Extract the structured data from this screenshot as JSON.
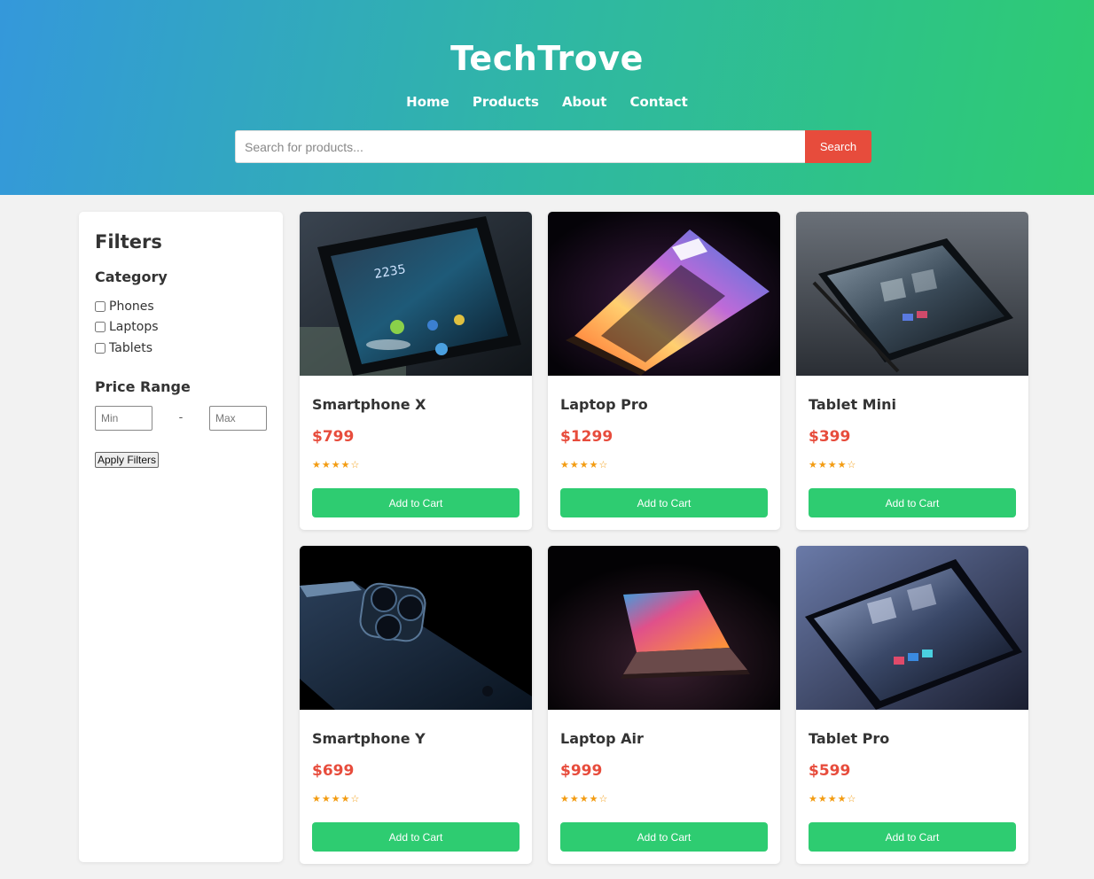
{
  "header": {
    "title": "TechTrove",
    "nav": [
      "Home",
      "Products",
      "About",
      "Contact"
    ],
    "search_placeholder": "Search for products...",
    "search_button": "Search",
    "gradient_colors": [
      "#3498db",
      "#2ecc71"
    ]
  },
  "sidebar": {
    "title": "Filters",
    "category_heading": "Category",
    "categories": [
      "Phones",
      "Laptops",
      "Tablets"
    ],
    "price_heading": "Price Range",
    "min_placeholder": "Min",
    "separator": "-",
    "max_placeholder": "Max",
    "apply_button": "Apply Filters"
  },
  "products": [
    {
      "name": "Smartphone X",
      "price": "$799",
      "rating": "★★★★☆",
      "button": "Add to Cart",
      "image_icon": "smartphone-photo"
    },
    {
      "name": "Laptop Pro",
      "price": "$1299",
      "rating": "★★★★☆",
      "button": "Add to Cart",
      "image_icon": "laptop-photo"
    },
    {
      "name": "Tablet Mini",
      "price": "$399",
      "rating": "★★★★☆",
      "button": "Add to Cart",
      "image_icon": "tablet-photo"
    },
    {
      "name": "Smartphone Y",
      "price": "$699",
      "rating": "★★★★☆",
      "button": "Add to Cart",
      "image_icon": "smartphone-photo"
    },
    {
      "name": "Laptop Air",
      "price": "$999",
      "rating": "★★★★☆",
      "button": "Add to Cart",
      "image_icon": "laptop-photo"
    },
    {
      "name": "Tablet Pro",
      "price": "$599",
      "rating": "★★★★☆",
      "button": "Add to Cart",
      "image_icon": "tablet-photo"
    }
  ],
  "colors": {
    "accent_green": "#2ecc71",
    "price_red": "#e74c3c",
    "star_orange": "#f39c12"
  }
}
